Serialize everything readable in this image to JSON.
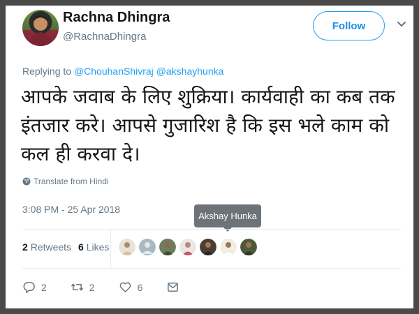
{
  "author": {
    "display_name": "Rachna Dhingra",
    "handle": "@RachnaDhingra",
    "avatar_icon": "profile-photo"
  },
  "follow_label": "Follow",
  "replying": {
    "prefix": "Replying to",
    "mentions": [
      "@ChouhanShivraj",
      "@akshayhunka"
    ]
  },
  "tweet_text": "आपके जवाब के लिए शुक्रिया। कार्यवाही का कब तक इंतजार करे। आपसे गुजारिश है कि इस भले काम को कल ही करवा दे।",
  "translate_label": "Translate from Hindi",
  "timestamp": "3:08 PM - 25 Apr 2018",
  "tooltip_text": "Akshay Hunka",
  "stats": {
    "retweets_count": "2",
    "retweets_label": "Retweets",
    "likes_count": "6",
    "likes_label": "Likes"
  },
  "likers": [
    {
      "icon": "liker-avatar-1",
      "color": "#c9b8a0"
    },
    {
      "icon": "liker-avatar-default",
      "color": "#aab8c2"
    },
    {
      "icon": "liker-avatar-3",
      "color": "#6b7d5a"
    },
    {
      "icon": "liker-avatar-4",
      "color": "#d7c3c5"
    },
    {
      "icon": "liker-avatar-5",
      "color": "#5a4a3e"
    },
    {
      "icon": "liker-avatar-6",
      "color": "#e6e0d0"
    },
    {
      "icon": "liker-avatar-7",
      "color": "#4d5a3a"
    }
  ],
  "actions": {
    "reply_count": "2",
    "retweet_count": "2",
    "like_count": "6"
  },
  "colors": {
    "accent": "#1da1f2",
    "muted": "#657786",
    "text": "#14171a",
    "frame": "#4a4a4a"
  }
}
